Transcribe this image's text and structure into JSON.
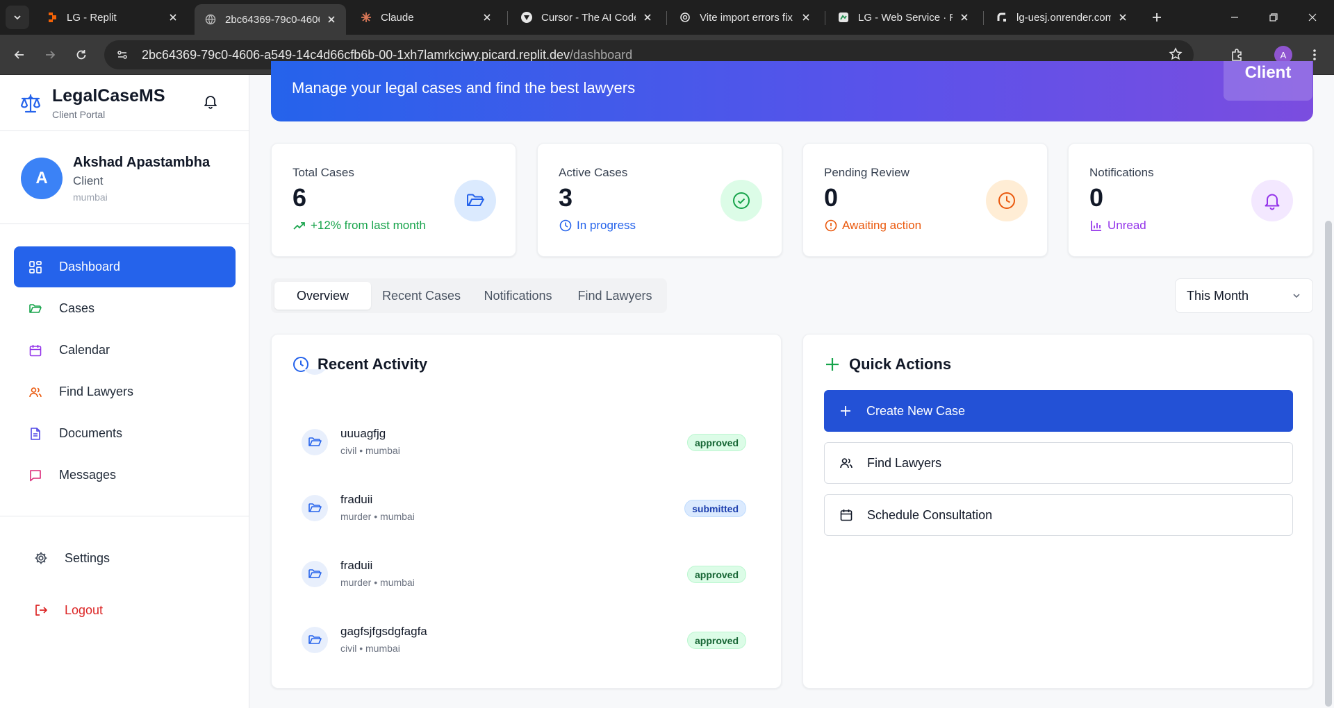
{
  "browser": {
    "tabs": [
      {
        "label": "LG - Replit",
        "icon": "replit-icon"
      },
      {
        "label": "2bc64369-79c0-4606",
        "icon": "globe-icon"
      },
      {
        "label": "Claude",
        "icon": "claude-icon"
      },
      {
        "label": "Cursor - The AI Code",
        "icon": "cursor-icon"
      },
      {
        "label": "Vite import errors fix",
        "icon": "openai-icon"
      },
      {
        "label": "LG - Web Service · R",
        "icon": "render-icon"
      },
      {
        "label": "lg-uesj.onrender.com",
        "icon": "render-icon"
      }
    ],
    "url_host": "2bc64369-79c0-4606-a549-14c4d66cfb6b-00-1xh7lamrkcjwy.picard.replit.dev",
    "url_path": "/dashboard",
    "profile_initial": "A"
  },
  "sidebar": {
    "brand_name": "LegalCaseMS",
    "brand_sub": "Client Portal",
    "user": {
      "initial": "A",
      "name": "Akshad Apastambha",
      "role": "Client",
      "location": "mumbai"
    },
    "nav": [
      {
        "label": "Dashboard",
        "icon": "grid-icon",
        "color": "#ffffff"
      },
      {
        "label": "Cases",
        "icon": "folder-icon",
        "color": "#16a34a"
      },
      {
        "label": "Calendar",
        "icon": "calendar-icon",
        "color": "#9333ea"
      },
      {
        "label": "Find Lawyers",
        "icon": "users-icon",
        "color": "#ea580c"
      },
      {
        "label": "Documents",
        "icon": "document-icon",
        "color": "#4f46e5"
      },
      {
        "label": "Messages",
        "icon": "message-icon",
        "color": "#db2777"
      }
    ],
    "settings_label": "Settings",
    "logout_label": "Logout"
  },
  "hero": {
    "subtitle": "Manage your legal cases and find the best lawyers",
    "badge": "Client"
  },
  "stats": [
    {
      "label": "Total Cases",
      "value": "6",
      "sub": "+12% from last month",
      "sub_color": "#16a34a",
      "circle_bg": "#dbeafe",
      "icon_color": "#2563eb",
      "icon": "folder-open-icon",
      "sub_icon": "trending-up-icon"
    },
    {
      "label": "Active Cases",
      "value": "3",
      "sub": "In progress",
      "sub_color": "#2563eb",
      "circle_bg": "#dcfce7",
      "icon_color": "#16a34a",
      "icon": "check-circle-icon",
      "sub_icon": "clock-icon"
    },
    {
      "label": "Pending Review",
      "value": "0",
      "sub": "Awaiting action",
      "sub_color": "#ea580c",
      "circle_bg": "#ffedd5",
      "icon_color": "#ea580c",
      "icon": "clock-icon",
      "sub_icon": "alert-circle-icon"
    },
    {
      "label": "Notifications",
      "value": "0",
      "sub": "Unread",
      "sub_color": "#9333ea",
      "circle_bg": "#f3e8ff",
      "icon_color": "#9333ea",
      "icon": "bell-icon",
      "sub_icon": "bar-chart-icon"
    }
  ],
  "tabs": [
    "Overview",
    "Recent Cases",
    "Notifications",
    "Find Lawyers"
  ],
  "period": "This Month",
  "recent_activity": {
    "title": "Recent Activity",
    "items": [
      {
        "title": "uuuagfjg",
        "meta": "civil • mumbai",
        "status": "approved"
      },
      {
        "title": "fraduii",
        "meta": "murder • mumbai",
        "status": "submitted"
      },
      {
        "title": "fraduii",
        "meta": "murder • mumbai",
        "status": "approved"
      },
      {
        "title": "gagfsjfgsdgfagfa",
        "meta": "civil • mumbai",
        "status": "approved"
      }
    ]
  },
  "quick_actions": {
    "title": "Quick Actions",
    "items": [
      {
        "label": "Create New Case",
        "icon": "plus-icon"
      },
      {
        "label": "Find Lawyers",
        "icon": "users-icon"
      },
      {
        "label": "Schedule Consultation",
        "icon": "calendar-icon"
      }
    ]
  }
}
